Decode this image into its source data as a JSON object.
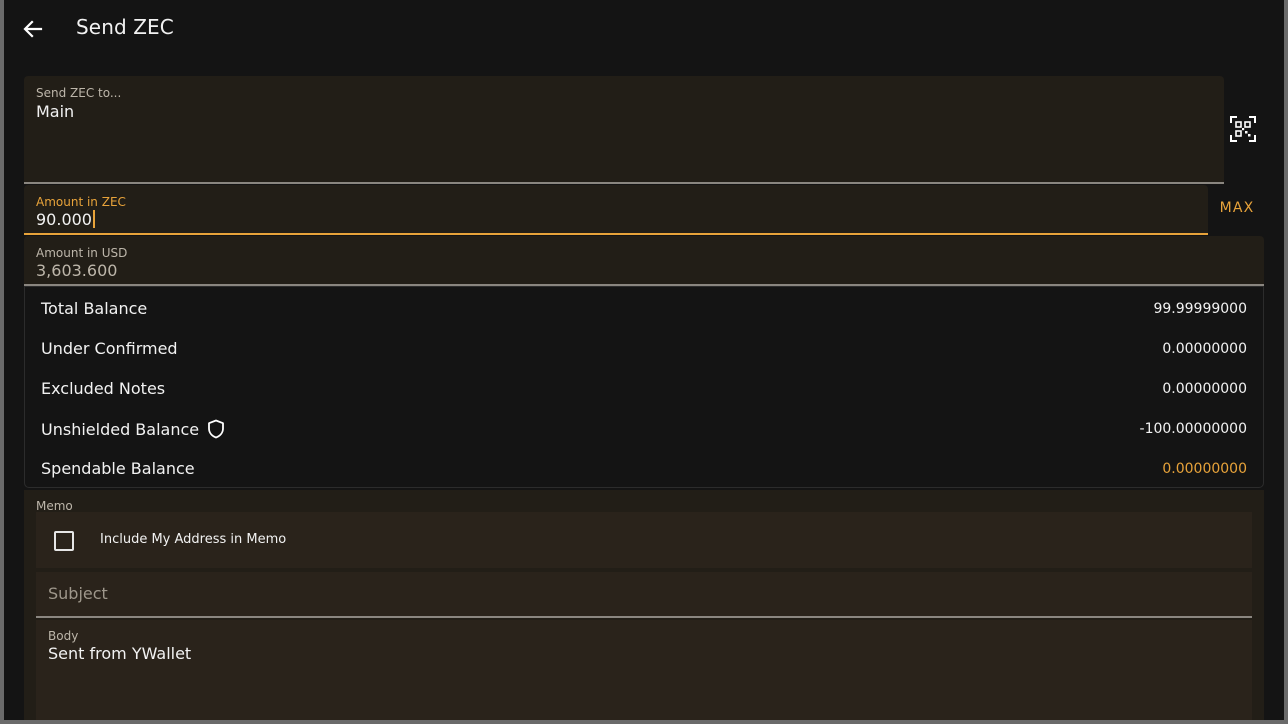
{
  "appbar": {
    "title": "Send ZEC",
    "back_icon": "arrow-left-icon"
  },
  "recipient": {
    "label": "Send ZEC to...",
    "value": "Main",
    "scan_icon": "qr-scan-icon"
  },
  "amount_zec": {
    "label": "Amount in ZEC",
    "value": "90.000",
    "max_label": "MAX"
  },
  "amount_usd": {
    "label": "Amount in USD",
    "value": "3,603.600"
  },
  "balances": {
    "total": {
      "label": "Total Balance",
      "value": "99.99999000"
    },
    "under_confirmed": {
      "label": "Under Confirmed",
      "value": "0.00000000"
    },
    "excluded": {
      "label": "Excluded Notes",
      "value": "0.00000000"
    },
    "unshielded": {
      "label": "Unshielded Balance",
      "value": "-100.00000000",
      "icon": "shield-icon"
    },
    "spendable": {
      "label": "Spendable Balance",
      "value": "0.00000000"
    }
  },
  "memo": {
    "label": "Memo",
    "include_address_label": "Include My Address in Memo",
    "include_address_checked": false,
    "subject_placeholder": "Subject",
    "body_label": "Body",
    "body_value": "Sent from YWallet"
  },
  "colors": {
    "accent": "#e8a33a",
    "background": "#141414",
    "field": "#221e17"
  }
}
